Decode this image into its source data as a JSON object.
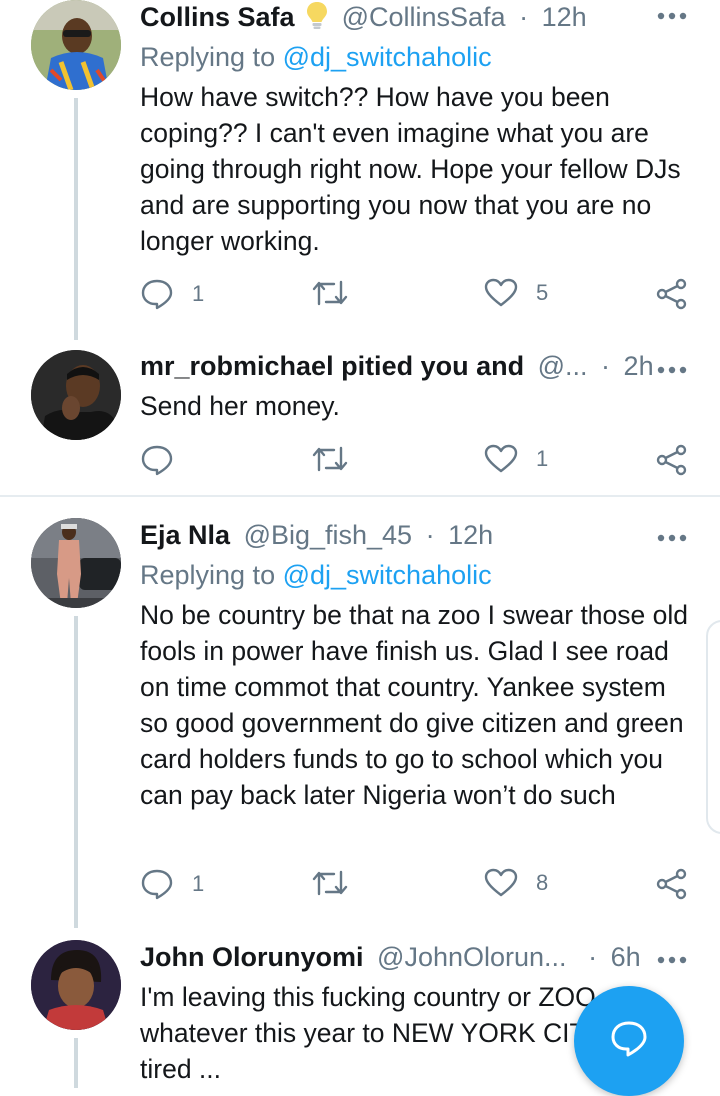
{
  "colors": {
    "accent": "#1da1f2",
    "muted": "#657786",
    "text": "#14171a",
    "fab": "#1da1f2"
  },
  "tweets": [
    {
      "name": "Collins Safa",
      "badge_icon": "lightbulb-icon",
      "handle": "@CollinsSafa",
      "separator": "·",
      "time": "12h",
      "replying_prefix": "Replying to",
      "replying_to": "@dj_switchaholic",
      "text": "How have switch?? How have you been coping?? I can't even imagine what you are going through right now. Hope your fellow DJs and are supporting you now that you are no longer working.",
      "replies": "1",
      "retweets": "",
      "likes": "5"
    },
    {
      "name": "mr_robmichael pitied you and",
      "handle": "@...",
      "separator": "·",
      "time": "2h",
      "text": "Send her money.",
      "replies": "",
      "retweets": "",
      "likes": "1"
    },
    {
      "name": "Eja Nla",
      "handle": "@Big_fish_45",
      "separator": "·",
      "time": "12h",
      "replying_prefix": "Replying to",
      "replying_to": "@dj_switchaholic",
      "text": "No be country be that na zoo I swear those old fools in power have finish us. Glad I see road on time commot that country. Yankee system so good government do give citizen and green card holders funds to go to school which you can pay back later Nigeria won’t do such",
      "replies": "1",
      "retweets": "",
      "likes": "8"
    },
    {
      "name": "John Olorunyomi",
      "handle": "@JohnOlorun...",
      "separator": "·",
      "time": "6h",
      "text": "I'm leaving this fucking country or ZOO whatever this year to NEW YORK CITY I'm tired ..."
    }
  ]
}
